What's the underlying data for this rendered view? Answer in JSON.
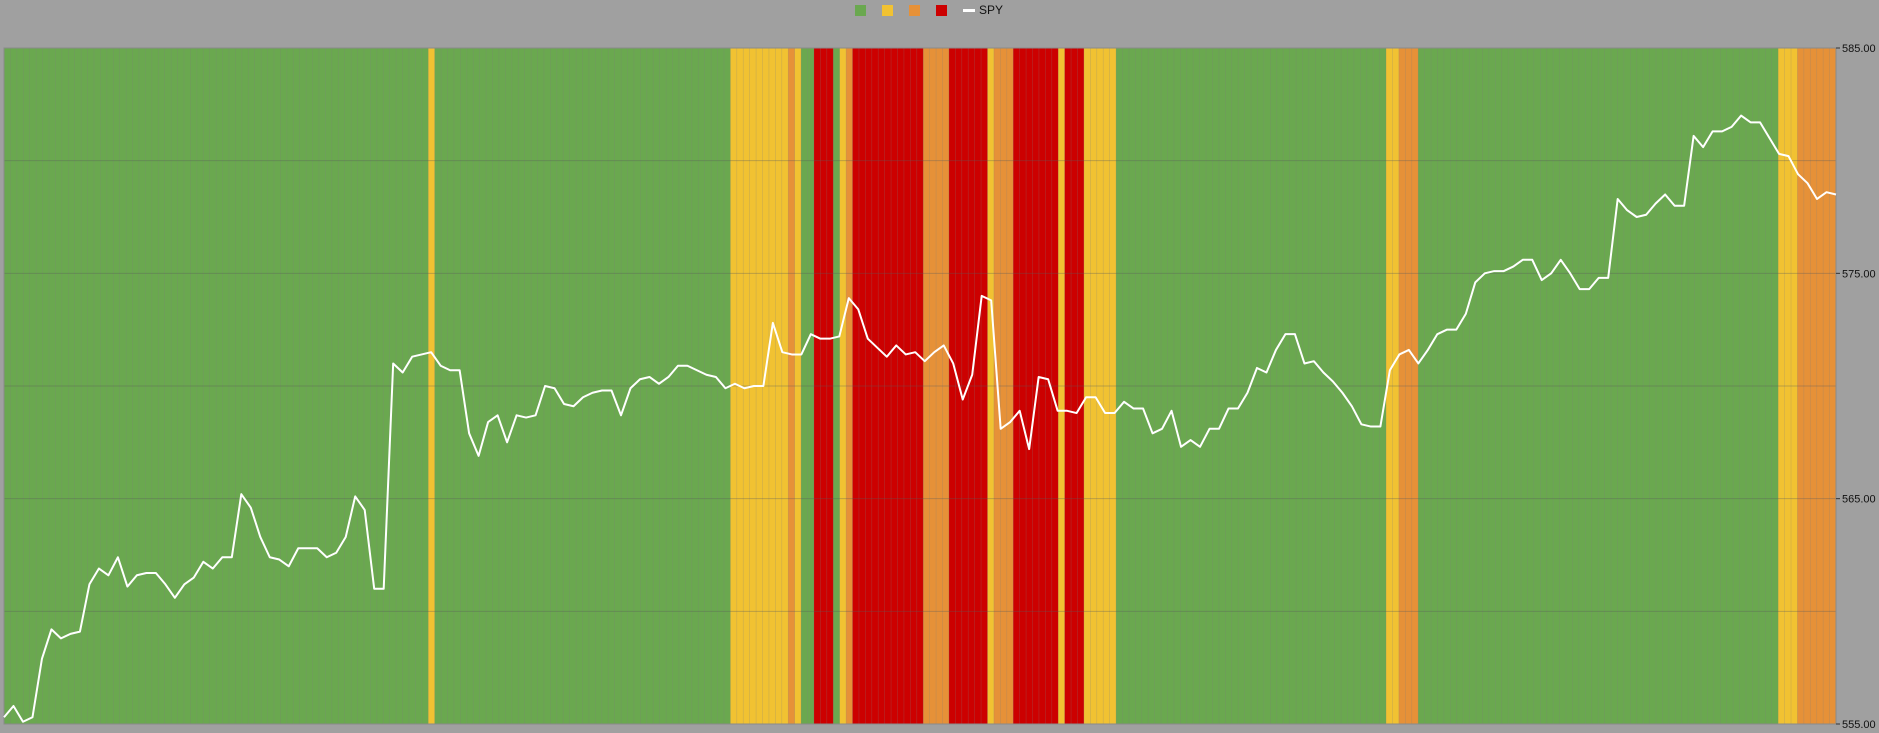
{
  "chart_data": {
    "type": "line",
    "title": "",
    "xlabel": "",
    "ylabel": "",
    "ylim": [
      555,
      585
    ],
    "y_ticks": [
      "585.00",
      "575.00",
      "565.00",
      "555.00"
    ],
    "grid": true,
    "legend_position": "top-center",
    "band_colors": {
      "G": "#6aa84f",
      "Y": "#f1c232",
      "O": "#e69138",
      "R": "#cc0000"
    },
    "legend": [
      {
        "key": "G",
        "label": ""
      },
      {
        "key": "Y",
        "label": ""
      },
      {
        "key": "O",
        "label": ""
      },
      {
        "key": "R",
        "label": ""
      }
    ],
    "line_color": "#ffffff",
    "bands": "GGGGGGGGGGGGGGGGGGGGGGGGGGGGGGGGGGGGGGGGGGGGGGGGGGGGGGGGGGGGGGGGGGYGGGGGGGGGGGGGGGGGGGGGGGGGGGGGGGGGGGGGGGGGGGGGGYYYYYYYYYOYGGRRRGYORRRRRRRRRRROOOORRRRRRYOOORRRRRRRYRRRYYYYYGGGGGGGGGGGGGGGGGGGGGGGGGGGGGGGGGGGGGGGGGGYYOOOGGGGGGGGGGGGGGGGGGGGGGGGGGGGGGGGGGGGGGGGGGGGGGGGGGGGGGGGYYYOOOOOO",
    "series": [
      {
        "name": "SPY",
        "values": [
          555.3,
          555.8,
          555.1,
          555.3,
          557.9,
          559.2,
          558.8,
          559.0,
          559.1,
          561.2,
          561.9,
          561.6,
          562.4,
          561.1,
          561.6,
          561.7,
          561.7,
          561.2,
          560.6,
          561.2,
          561.5,
          562.2,
          561.9,
          562.4,
          562.4,
          565.2,
          564.6,
          563.3,
          562.4,
          562.3,
          562.0,
          562.8,
          562.8,
          562.8,
          562.4,
          562.6,
          563.3,
          565.1,
          564.5,
          561.0,
          561.0,
          571.0,
          570.6,
          571.3,
          571.4,
          571.5,
          570.9,
          570.7,
          570.7,
          567.9,
          566.9,
          568.4,
          568.7,
          567.5,
          568.7,
          568.6,
          568.7,
          570.0,
          569.9,
          569.2,
          569.1,
          569.5,
          569.7,
          569.8,
          569.8,
          568.7,
          569.9,
          570.3,
          570.4,
          570.1,
          570.4,
          570.9,
          570.9,
          570.7,
          570.5,
          570.4,
          569.9,
          570.1,
          569.9,
          570.0,
          570.0,
          572.8,
          571.5,
          571.4,
          571.4,
          572.3,
          572.1,
          572.1,
          572.2,
          573.9,
          573.4,
          572.1,
          571.7,
          571.3,
          571.8,
          571.4,
          571.5,
          571.1,
          571.5,
          571.8,
          571.0,
          569.4,
          570.5,
          574.0,
          573.8,
          568.1,
          568.4,
          568.9,
          567.2,
          570.4,
          570.3,
          568.9,
          568.9,
          568.8,
          569.5,
          569.5,
          568.8,
          568.8,
          569.3,
          569.0,
          569.0,
          567.9,
          568.1,
          568.9,
          567.3,
          567.6,
          567.3,
          568.1,
          568.1,
          569.0,
          569.0,
          569.7,
          570.8,
          570.6,
          571.6,
          572.3,
          572.3,
          571.0,
          571.1,
          570.6,
          570.2,
          569.7,
          569.1,
          568.3,
          568.2,
          568.2,
          570.7,
          571.4,
          571.6,
          571.0,
          571.6,
          572.3,
          572.5,
          572.5,
          573.2,
          574.6,
          575.0,
          575.1,
          575.1,
          575.3,
          575.6,
          575.6,
          574.7,
          575.0,
          575.6,
          575.0,
          574.3,
          574.3,
          574.8,
          574.8,
          578.3,
          577.8,
          577.5,
          577.6,
          578.1,
          578.5,
          578.0,
          578.0,
          581.1,
          580.6,
          581.3,
          581.3,
          581.5,
          582.0,
          581.7,
          581.7,
          581.0,
          580.3,
          580.2,
          579.4,
          579.0,
          578.3,
          578.6,
          578.5
        ]
      }
    ]
  }
}
